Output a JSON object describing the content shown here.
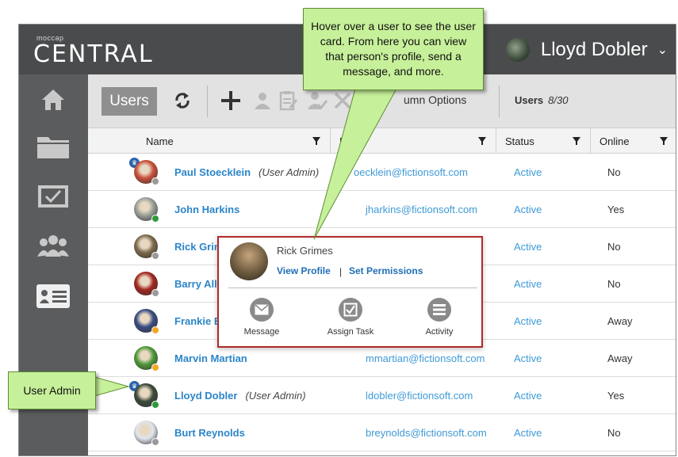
{
  "app": {
    "logo_small": "moccap",
    "logo_big": "CENTRAL",
    "current_user": "Lloyd Dobler"
  },
  "toolbar": {
    "tab_label": "Users",
    "column_options_label": "Column Options",
    "column_options_visible": "umn Options",
    "users_label": "Users",
    "users_count": "8/30"
  },
  "table": {
    "headers": [
      "Name",
      "Email",
      "Status",
      "Online"
    ],
    "rows": [
      {
        "name": "Paul Stoecklein",
        "admin": "(User Admin)",
        "email": "pstoecklein@fictionsoft.com",
        "email_visible": "oecklein@fictionsoft.com",
        "status": "Active",
        "online": "No",
        "presence": "offline",
        "avatar_color": "#c9503a"
      },
      {
        "name": "John Harkins",
        "admin": "",
        "email": "jharkins@fictionsoft.com",
        "email_visible": "jharkins@fictionsoft.com",
        "status": "Active",
        "online": "Yes",
        "presence": "online",
        "avatar_color": "#9aa19a"
      },
      {
        "name": "Rick Grimes",
        "admin": "",
        "email": "",
        "email_visible": "",
        "status": "Active",
        "online": "No",
        "presence": "offline",
        "avatar_color": "#7d6a4c"
      },
      {
        "name": "Barry Allen",
        "admin": "",
        "email": "",
        "email_visible": "",
        "status": "Active",
        "online": "No",
        "presence": "offline",
        "avatar_color": "#a3261f"
      },
      {
        "name": "Frankie Bones",
        "admin": "",
        "email": "",
        "email_visible": "",
        "status": "Active",
        "online": "Away",
        "presence": "away",
        "avatar_color": "#3a4c82"
      },
      {
        "name": "Marvin Martian",
        "admin": "",
        "email": "mmartian@fictionsoft.com",
        "email_visible": "mmartian@fictionsoft.com",
        "status": "Active",
        "online": "Away",
        "presence": "away",
        "avatar_color": "#4f9a3a"
      },
      {
        "name": "Lloyd Dobler",
        "admin": "(User Admin)",
        "email": "ldobler@fictionsoft.com",
        "email_visible": "ldobler@fictionsoft.com",
        "status": "Active",
        "online": "Yes",
        "presence": "online",
        "avatar_color": "#3b4a3a"
      },
      {
        "name": "Burt Reynolds",
        "admin": "",
        "email": "breynolds@fictionsoft.com",
        "email_visible": "breynolds@fictionsoft.com",
        "status": "Active",
        "online": "No",
        "presence": "offline",
        "avatar_color": "#dfe5ee"
      }
    ],
    "visible_name_prefix": {
      "rick": "Rick Grim",
      "barry": "Barry Alle",
      "frankie": "Frankie B"
    }
  },
  "user_card": {
    "name": "Rick Grimes",
    "view_profile": "View Profile",
    "set_permissions": "Set Permissions",
    "actions": [
      {
        "label": "Message",
        "icon": "envelope-icon"
      },
      {
        "label": "Assign Task",
        "icon": "checkbox-icon"
      },
      {
        "label": "Activity",
        "icon": "list-icon"
      }
    ]
  },
  "callouts": {
    "hover": "Hover over a user to see the user card. From here you can view that person's profile, send a message, and more.",
    "admin": "User Admin"
  },
  "colors": {
    "topbar": "#4a4b4d",
    "sidebar": "#5b5c5e",
    "link": "#2b85c9",
    "callout": "#c7f09a",
    "card_border": "#b02a2a",
    "online": "#2e9a3a",
    "away": "#f5a623",
    "offline": "#9a9a9a"
  }
}
